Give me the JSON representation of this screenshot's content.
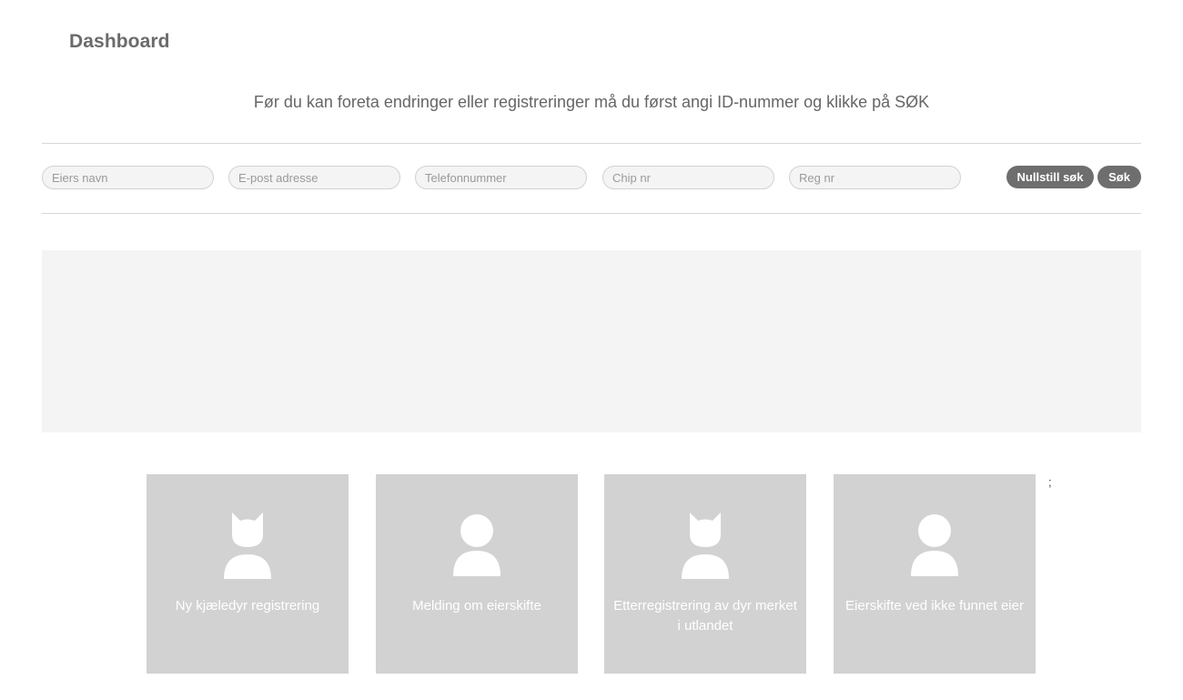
{
  "header": {
    "title": "Dashboard"
  },
  "instruction": "Før du kan foreta endringer eller registreringer må du først angi ID-nummer og klikke på SØK",
  "search": {
    "fields": [
      {
        "placeholder": "Eiers navn",
        "value": ""
      },
      {
        "placeholder": "E-post adresse",
        "value": ""
      },
      {
        "placeholder": "Telefonnummer",
        "value": ""
      },
      {
        "placeholder": "Chip nr",
        "value": ""
      },
      {
        "placeholder": "Reg nr",
        "value": ""
      }
    ],
    "reset_label": "Nullstill søk",
    "search_label": "Søk"
  },
  "tiles": [
    {
      "icon": "pet-icon",
      "label": "Ny kjæledyr registrering"
    },
    {
      "icon": "person-icon",
      "label": "Melding om eierskifte"
    },
    {
      "icon": "pet-icon",
      "label": "Etterregistrering av dyr merket i utlandet"
    },
    {
      "icon": "person-icon",
      "label": "Eierskifte ved ikke funnet eier"
    }
  ],
  "stray_text": ";",
  "colors": {
    "tile_background": "#d2d2d2",
    "button_background": "#6e6e6e",
    "panel_background": "#f4f4f4",
    "divider": "#d6d6d6"
  }
}
